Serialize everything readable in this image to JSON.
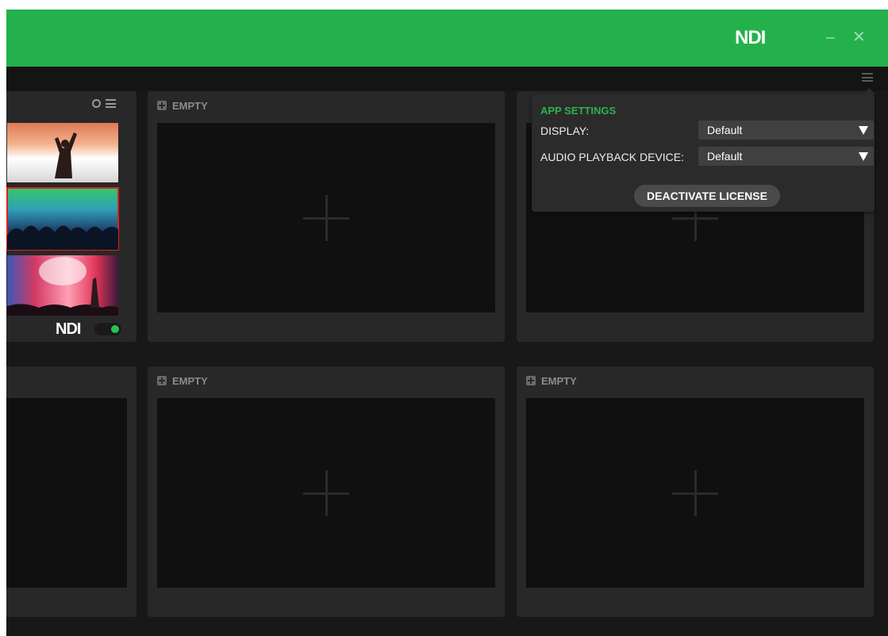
{
  "titlebar": {
    "logo": "NDI",
    "minimize_label": "–",
    "close_label": "✕",
    "color": "#24b14c"
  },
  "panels": [
    {
      "header": "EMPTY"
    },
    {
      "header": "EMPTY"
    },
    {
      "header": "EMPTY"
    },
    {
      "header": "EMPTY"
    }
  ],
  "source_panel": {
    "thumbnails": [
      {
        "label": ""
      },
      {
        "label": ""
      },
      {
        "label": ""
      }
    ],
    "footer_logo": "NDI",
    "toggle_on": true
  },
  "app_settings": {
    "title": "APP SETTINGS",
    "display_label": "DISPLAY:",
    "display_value": "Default",
    "audio_label": "AUDIO PLAYBACK DEVICE:",
    "audio_value": "Default",
    "deactivate_label": "DEACTIVATE LICENSE",
    "accent_color": "#2bb34e"
  },
  "icons": {
    "menu": "hamburger-menu-icon",
    "refresh": "refresh-icon",
    "list": "list-icon",
    "add": "plus-icon"
  }
}
